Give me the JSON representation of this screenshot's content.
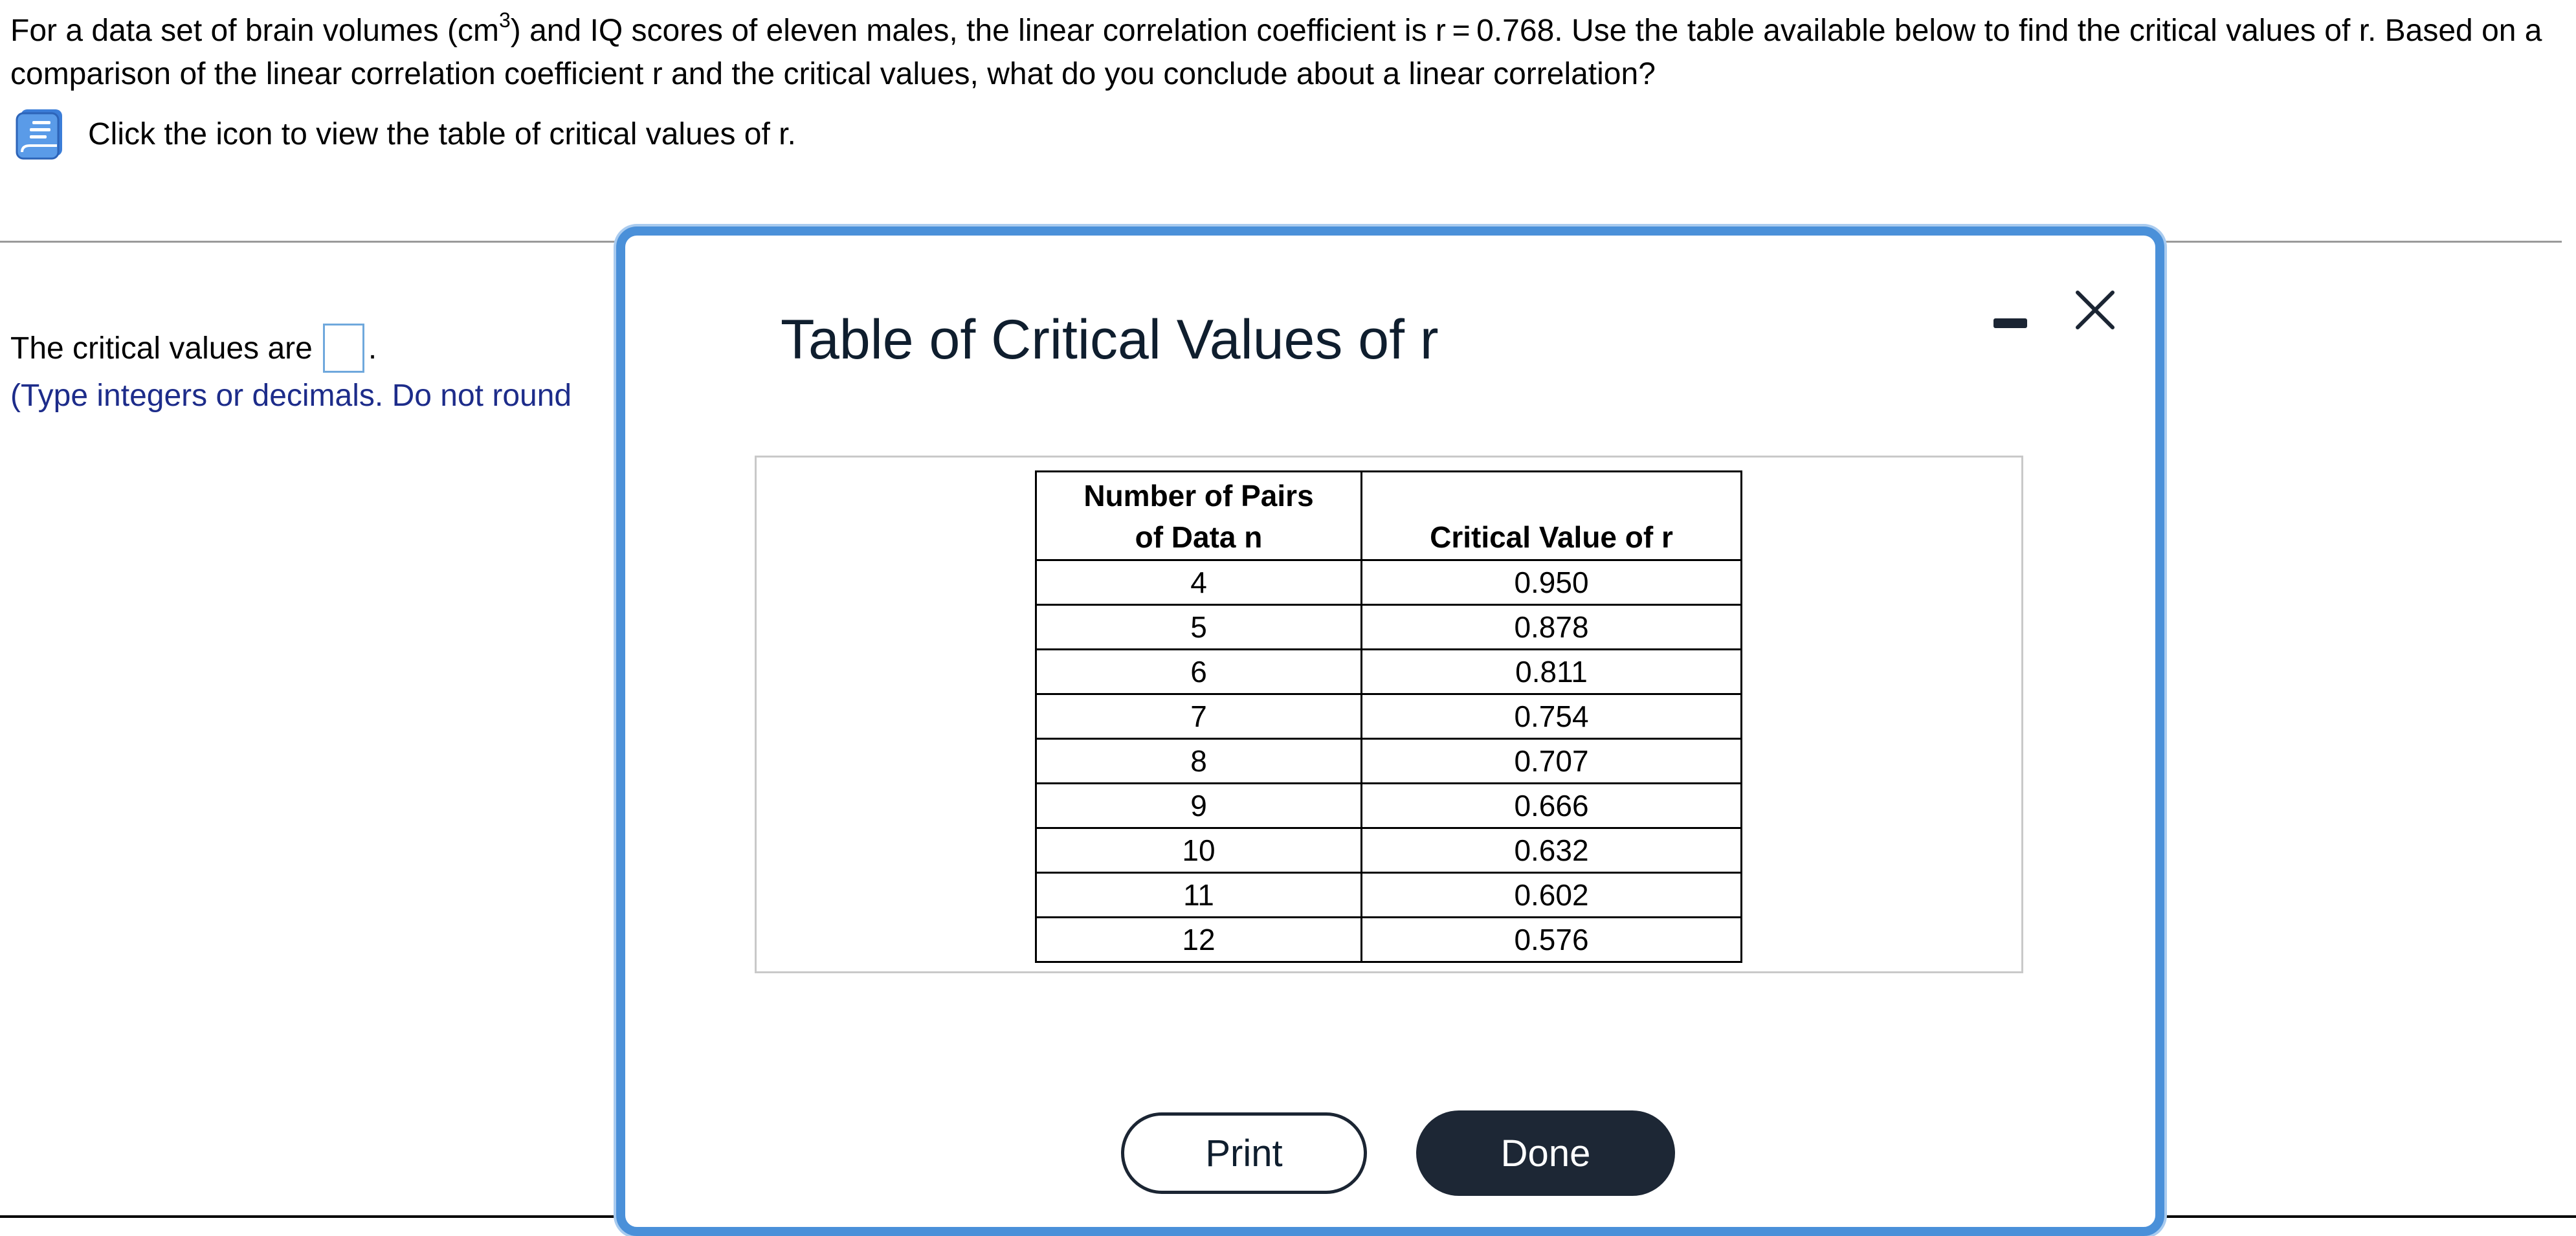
{
  "question": {
    "part1": "For a data set of brain volumes (cm",
    "superscript": "3",
    "part2": ") and IQ scores of eleven males, the linear correlation coefficient is r = 0.768. Use the table available below to find the critical values of r. Based on a comparison of the linear correlation coefficient r and the critical values, what do you conclude about a linear correlation?"
  },
  "hint": {
    "icon": "book-icon",
    "text": "Click the icon to view the table of critical values of r."
  },
  "answer": {
    "prefix": "The critical values are",
    "value": "",
    "suffix": ".",
    "instruction": "(Type integers or decimals. Do not round"
  },
  "modal": {
    "title": "Table of Critical Values of r",
    "minimize_icon": "minimize-icon",
    "close_icon": "close-icon",
    "table": {
      "headers": {
        "n_line1": "Number of Pairs",
        "n_line2": "of Data n",
        "r": "Critical Value of r"
      },
      "rows": [
        {
          "n": "4",
          "r": "0.950"
        },
        {
          "n": "5",
          "r": "0.878"
        },
        {
          "n": "6",
          "r": "0.811"
        },
        {
          "n": "7",
          "r": "0.754"
        },
        {
          "n": "8",
          "r": "0.707"
        },
        {
          "n": "9",
          "r": "0.666"
        },
        {
          "n": "10",
          "r": "0.632"
        },
        {
          "n": "11",
          "r": "0.602"
        },
        {
          "n": "12",
          "r": "0.576"
        }
      ]
    },
    "print_label": "Print",
    "done_label": "Done"
  },
  "colors": {
    "modal_border": "#4a90d9",
    "instruction_text": "#1d2c8a",
    "done_button": "#1d2735",
    "answer_box_border": "#6fa8dc"
  }
}
